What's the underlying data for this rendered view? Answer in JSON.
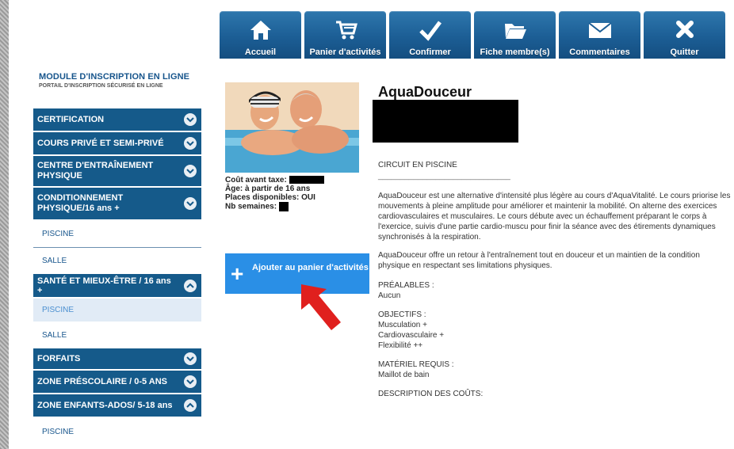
{
  "nav": [
    {
      "label": "Accueil",
      "icon": "home-icon"
    },
    {
      "label": "Panier d'activités",
      "icon": "cart-icon"
    },
    {
      "label": "Confirmer",
      "icon": "checkmark-icon"
    },
    {
      "label": "Fiche membre(s)",
      "icon": "folder-icon"
    },
    {
      "label": "Commentaires",
      "icon": "envelope-icon"
    },
    {
      "label": "Quitter",
      "icon": "close-icon"
    }
  ],
  "brand": {
    "title": "MODULE D'INSCRIPTION EN LIGNE",
    "subtitle": "PORTAIL D'INSCRIPTION SÉCURISÉ EN LIGNE"
  },
  "sidebar": {
    "items": [
      {
        "type": "category",
        "label": "CERTIFICATION",
        "expanded": false
      },
      {
        "type": "category",
        "label": "COURS PRIVÉ ET SEMI-PRIVÉ",
        "expanded": false
      },
      {
        "type": "category",
        "label": "CENTRE D'ENTRAÎNEMENT PHYSIQUE",
        "expanded": false
      },
      {
        "type": "category",
        "label": "CONDITIONNEMENT PHYSIQUE/16 ans +",
        "expanded": false
      },
      {
        "type": "sub",
        "label": "PISCINE"
      },
      {
        "type": "sub",
        "label": "SALLE"
      },
      {
        "type": "category",
        "label": "SANTÉ ET MIEUX-ÊTRE / 16 ans +",
        "expanded": true
      },
      {
        "type": "sub",
        "label": "PISCINE",
        "active": true
      },
      {
        "type": "sub",
        "label": "SALLE"
      },
      {
        "type": "category",
        "label": "FORFAITS",
        "expanded": false
      },
      {
        "type": "category",
        "label": "ZONE PRÉSCOLAIRE / 0-5 ANS",
        "expanded": false
      },
      {
        "type": "category",
        "label": "ZONE ENFANTS-ADOS/ 5-18 ans",
        "expanded": true
      },
      {
        "type": "sub",
        "label": "PISCINE"
      }
    ]
  },
  "activity": {
    "cost_label": "Coût avant taxe:",
    "age_label": "Âge: à partir de 16 ans",
    "places_label": "Places disponibles: OUI",
    "weeks_label": "Nb semaines:",
    "add_button": "Ajouter au panier d'activités"
  },
  "detail": {
    "title": "AquaDouceur",
    "category": "CIRCUIT EN PISCINE",
    "separator": "______________________________",
    "description_1": "AquaDouceur est une alternative d'intensité plus légère au cours d'AquaVitalité. Le cours priorise les mouvements à pleine amplitude pour améliorer et maintenir la mobilité. On alterne des exercices cardiovasculaires et musculaires. Le cours débute avec un échauffement préparant le corps à l'exercice, suivis d'une partie cardio-muscu pour finir la séance avec des étirements dynamiques synchronisés à la respiration.",
    "description_2": "AquaDouceur offre un retour à l'entraînement tout en douceur et un maintien de la condition physique en respectant ses limitations physiques.",
    "prereq_label": "PRÉALABLES :",
    "prereq_value": "Aucun",
    "objectives_label": "OBJECTIFS :",
    "objectives": [
      "Musculation +",
      "Cardiovasculaire +",
      "Flexibilité ++"
    ],
    "equipment_label": "MATÉRIEL REQUIS :",
    "equipment_value": "Maillot de bain",
    "costs_label": "DESCRIPTION DES COÛTS:"
  },
  "colors": {
    "nav_blue": "#1c5e95",
    "sidebar_blue": "#155a8a",
    "add_button": "#2a8fe6",
    "arrow": "#e0201e"
  }
}
